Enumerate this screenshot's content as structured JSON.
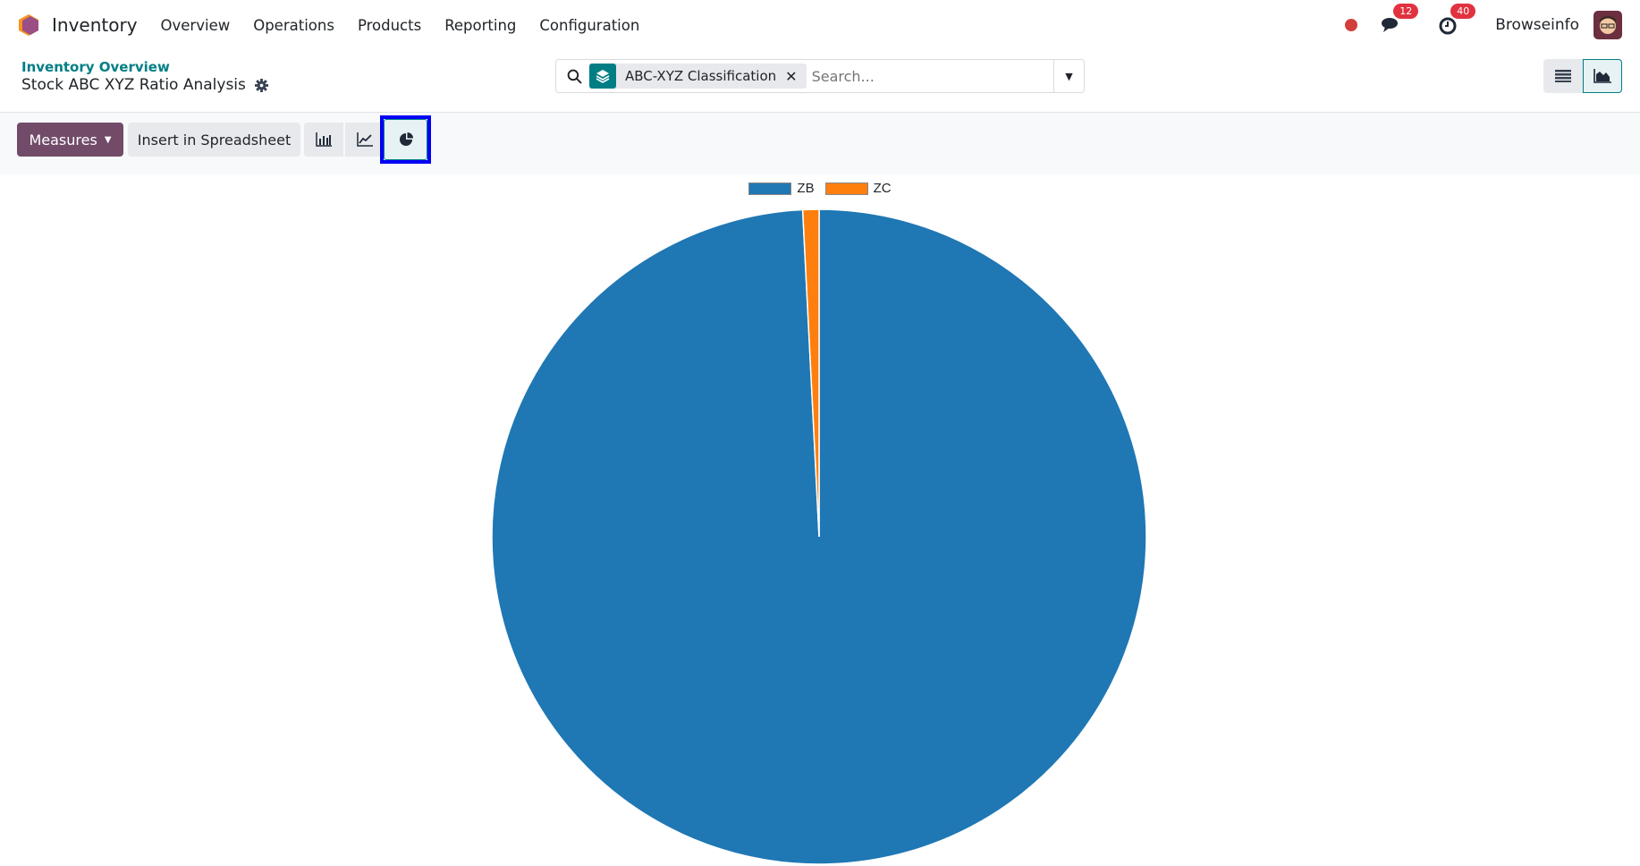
{
  "navbar": {
    "app_name": "Inventory",
    "menu": [
      "Overview",
      "Operations",
      "Products",
      "Reporting",
      "Configuration"
    ],
    "messages_count": "12",
    "activities_count": "40",
    "user": "Browseinfo"
  },
  "control_panel": {
    "breadcrumb": "Inventory Overview",
    "title": "Stock ABC XYZ Ratio Analysis",
    "facet": "ABC-XYZ Classification",
    "search_placeholder": "Search..."
  },
  "toolbar": {
    "measures": "Measures",
    "insert": "Insert in Spreadsheet",
    "active_chart": "pie"
  },
  "chart_data": {
    "type": "pie",
    "title": "",
    "labels": [
      "ZB",
      "ZC"
    ],
    "values": [
      99.2,
      0.8
    ],
    "colors": [
      "#1f77b4",
      "#ff7f0e"
    ],
    "legend": "top"
  }
}
